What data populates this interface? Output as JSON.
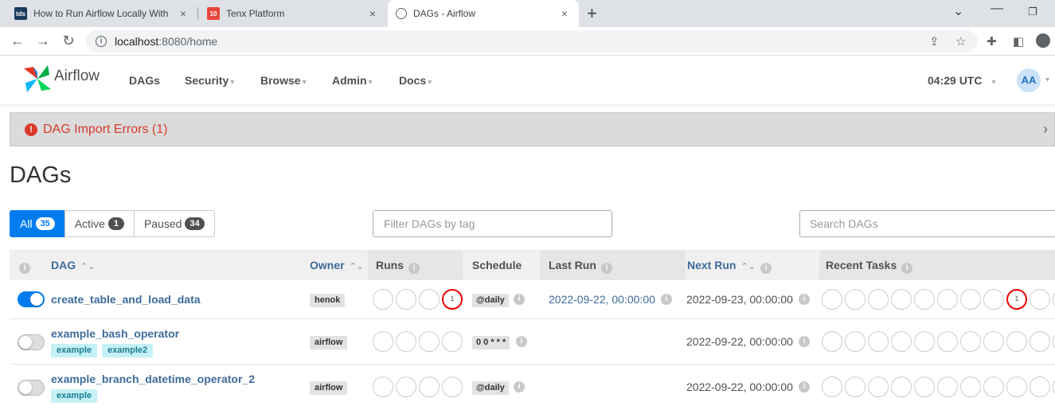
{
  "browser": {
    "tabs": [
      {
        "title": "How to Run Airflow Locally With",
        "favicon": "tds",
        "close": "×"
      },
      {
        "title": "Tenx Platform",
        "favicon": "10",
        "close": "×"
      },
      {
        "title": "DAGs - Airflow",
        "favicon": "",
        "close": "×"
      }
    ],
    "new_tab": "+",
    "url_host": "localhost",
    "url_path": ":8080/home"
  },
  "navbar": {
    "brand": "Airflow",
    "menus": [
      {
        "label": "DAGs",
        "dropdown": false
      },
      {
        "label": "Security",
        "dropdown": true
      },
      {
        "label": "Browse",
        "dropdown": true
      },
      {
        "label": "Admin",
        "dropdown": true
      },
      {
        "label": "Docs",
        "dropdown": true
      }
    ],
    "clock": "04:29 UTC",
    "avatar": "AA"
  },
  "import_errors": {
    "label": "DAG Import Errors (1)"
  },
  "page_title": "DAGs",
  "filters": {
    "all_label": "All",
    "all_count": "35",
    "active_label": "Active",
    "active_count": "1",
    "paused_label": "Paused",
    "paused_count": "34",
    "tag_placeholder": "Filter DAGs by tag",
    "search_placeholder": "Search DAGs"
  },
  "table": {
    "headers": {
      "dag": "DAG",
      "owner": "Owner",
      "runs": "Runs",
      "schedule": "Schedule",
      "last_run": "Last Run",
      "next_run": "Next Run",
      "recent_tasks": "Recent Tasks"
    },
    "rows": [
      {
        "name": "create_table_and_load_data",
        "paused": false,
        "tags": [],
        "owner": "henok",
        "runs": [
          "",
          "",
          "",
          "1"
        ],
        "runs_failed_index": 3,
        "schedule": "@daily",
        "last_run": "2022-09-22, 00:00:00",
        "next_run": "2022-09-23, 00:00:00",
        "recent_tasks_failed": "1"
      },
      {
        "name": "example_bash_operator",
        "paused": true,
        "tags": [
          "example",
          "example2"
        ],
        "owner": "airflow",
        "runs": [
          "",
          "",
          "",
          ""
        ],
        "schedule": "0 0 * * *",
        "last_run": "",
        "next_run": "2022-09-22, 00:00:00"
      },
      {
        "name": "example_branch_datetime_operator_2",
        "paused": true,
        "tags": [
          "example"
        ],
        "owner": "airflow",
        "runs": [
          "",
          "",
          "",
          ""
        ],
        "schedule": "@daily",
        "last_run": "",
        "next_run": "2022-09-22, 00:00:00"
      }
    ]
  },
  "colors": {
    "primary": "#017cee",
    "error": "#d9392b",
    "link": "#3d6b9c",
    "tag_bg": "#c5f1f6"
  }
}
